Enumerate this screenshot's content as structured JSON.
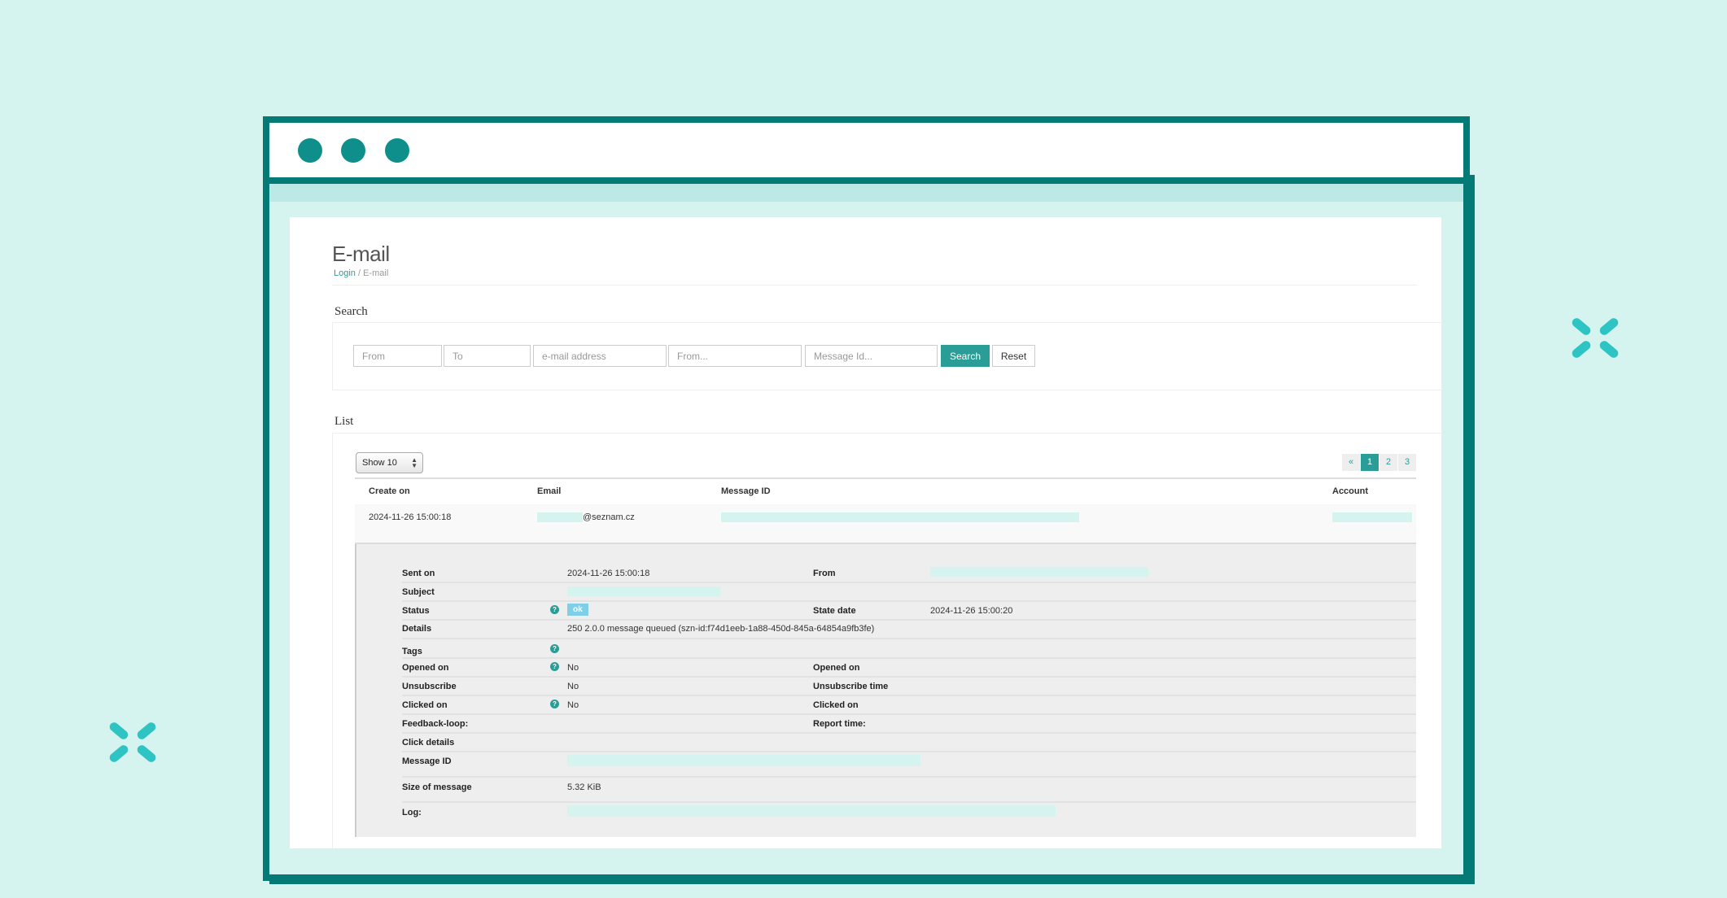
{
  "window": {
    "dots": [
      "window-dot-1",
      "window-dot-2",
      "window-dot-3"
    ]
  },
  "page": {
    "title": "E-mail",
    "breadcrumb": {
      "root": "Login",
      "separator": " / ",
      "current": "E-mail"
    }
  },
  "search": {
    "section_label": "Search",
    "fields": [
      {
        "name": "date-from-input",
        "placeholder": "From",
        "value": ""
      },
      {
        "name": "date-to-input",
        "placeholder": "To",
        "value": ""
      },
      {
        "name": "email-address-input",
        "placeholder": "e-mail address",
        "value": ""
      },
      {
        "name": "sender-input",
        "placeholder": "From...",
        "value": ""
      },
      {
        "name": "message-id-input",
        "placeholder": "Message Id...",
        "value": ""
      }
    ],
    "search_label": "Search",
    "reset_label": "Reset"
  },
  "list": {
    "section_label": "List",
    "page_size": "Show 10",
    "pagination": {
      "prev": "«",
      "pages": [
        "1",
        "2",
        "3"
      ],
      "active": "1"
    },
    "columns": [
      "Create on",
      "Email",
      "Message ID",
      "Account"
    ],
    "rows": [
      {
        "created_on": "2024-11-26 15:00:18",
        "email_domain": "@seznam.cz",
        "message_id": "[redacted]",
        "account": "[redacted]"
      }
    ]
  },
  "detail": {
    "sent_on_label": "Sent on",
    "sent_on": "2024-11-26 15:00:18",
    "from_label": "From",
    "from": "[redacted]",
    "subject_label": "Subject",
    "subject": "[redacted]",
    "status_label": "Status",
    "status": "ok",
    "state_date_label": "State date",
    "state_date": "2024-11-26 15:00:20",
    "details_label": "Details",
    "details": "250 2.0.0 message queued (szn-id:f74d1eeb-1a88-450d-845a-64854a9fb3fe)",
    "tags_label": "Tags",
    "opened_on_label": "Opened on",
    "opened_on": "No",
    "opened_on_right_label": "Opened on",
    "unsubscribe_label": "Unsubscribe",
    "unsubscribe": "No",
    "unsubscribe_time_label": "Unsubscribe time",
    "clicked_on_label": "Clicked on",
    "clicked_on": "No",
    "clicked_on_right_label": "Clicked on",
    "feedback_loop_label": "Feedback-loop:",
    "report_time_label": "Report time:",
    "click_details_label": "Click details",
    "message_id_label": "Message ID",
    "message_id": "[redacted]",
    "size_label": "Size of message",
    "size": "5.32 KiB",
    "log_label": "Log:",
    "log": "[redacted]",
    "help_glyph": "?"
  },
  "colors": {
    "accent": "#2a9d96",
    "frame": "#047a77",
    "background": "#d6f4ef",
    "status_ok": "#7fcfe8"
  }
}
